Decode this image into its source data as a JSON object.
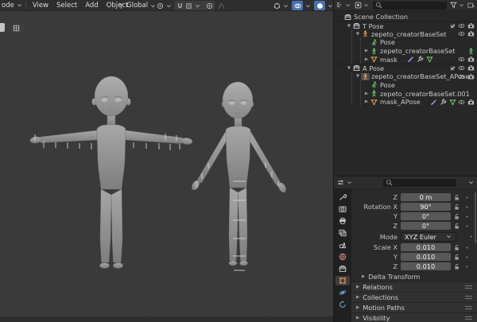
{
  "colors": {
    "accent": "#4772b4",
    "object_orange": "#ee9e55",
    "data_green": "#6ecf6e",
    "brush_purple": "#9b8ce8",
    "world_red": "#cf8080",
    "physics_blue": "#6f9fd8",
    "viewport_bg": "#3a3a3b"
  },
  "menubar": {
    "mode_label": "ode",
    "menus": [
      "View",
      "Select",
      "Add",
      "Object"
    ],
    "orientation_label": "Global"
  },
  "outliner": {
    "search_placeholder": "",
    "rows": [
      {
        "label": "Scene Collection",
        "level": 0,
        "icon": "collection",
        "icolor": "#cfcfcf",
        "right": []
      },
      {
        "label": "T Pose",
        "level": 1,
        "disc": "open",
        "icon": "collection",
        "icolor": "#cfcfcf",
        "right": [
          "check",
          "eye",
          "camera"
        ],
        "sep": true
      },
      {
        "label": "zepeto_creatorBaseSet",
        "level": 2,
        "disc": "open",
        "icon": "armature",
        "icolor": "#ee9e55",
        "right": [
          "eye",
          "camera"
        ]
      },
      {
        "label": "Pose",
        "level": 3,
        "icon": "pose",
        "icolor": "#6ecf6e",
        "right": []
      },
      {
        "label": "zepeto_creatorBaseSet",
        "level": 3,
        "disc": "closed",
        "icon": "armature",
        "icolor": "#6ecf6e",
        "right": [
          "badge-armature"
        ]
      },
      {
        "label": "mask",
        "level": 3,
        "disc": "closed",
        "icon": "mesh",
        "icolor": "#ee9e55",
        "badges": [
          "brush",
          "modifier",
          "mesh-green"
        ],
        "right": [
          "eye",
          "camera"
        ]
      },
      {
        "label": "A Pose",
        "level": 1,
        "disc": "open",
        "icon": "collection",
        "icolor": "#cfcfcf",
        "right": [
          "check",
          "eye",
          "camera"
        ],
        "sep": true
      },
      {
        "label": "zepeto_creatorBaseSet_APose",
        "level": 2,
        "disc": "open",
        "icon": "armature",
        "icolor": "#ee9e55",
        "iconbg": true,
        "right": [
          "eye",
          "camera"
        ]
      },
      {
        "label": "Pose",
        "level": 3,
        "icon": "pose",
        "icolor": "#6ecf6e",
        "right": []
      },
      {
        "label": "zepeto_creatorBaseSet.001",
        "level": 3,
        "disc": "closed",
        "icon": "armature",
        "icolor": "#6ecf6e",
        "right": []
      },
      {
        "label": "mask_APose",
        "level": 3,
        "disc": "closed",
        "icon": "mesh",
        "icolor": "#ee9e55",
        "badges": [
          "brush",
          "modifier",
          "mesh-green"
        ],
        "right": [
          "eye",
          "camera"
        ]
      }
    ]
  },
  "properties": {
    "search_placeholder": "",
    "tabs": [
      {
        "name": "tool",
        "color": "#c8c8c8"
      },
      {
        "name": "render",
        "color": "#c8c8c8"
      },
      {
        "name": "output",
        "color": "#c8c8c8"
      },
      {
        "name": "view-layer",
        "color": "#c8c8c8"
      },
      {
        "name": "scene",
        "color": "#c8c8c8"
      },
      {
        "name": "world",
        "color": "#cf8080"
      },
      {
        "name": "collection",
        "color": "#c8c8c8"
      },
      {
        "name": "object",
        "color": "#ee9e55",
        "active": true
      },
      {
        "name": "physics",
        "color": "#6f9fd8"
      },
      {
        "name": "constraints",
        "color": "#6f9fd8"
      }
    ],
    "fields": [
      {
        "label": "Z",
        "value": "0 m",
        "lock": true
      },
      {
        "label": "Rotation X",
        "value": "90°",
        "lock": true
      },
      {
        "label": "Y",
        "value": "0°",
        "lock": true
      },
      {
        "label": "Z",
        "value": "0°",
        "lock": true
      },
      {
        "label": "Mode",
        "value": "XYZ Euler",
        "type": "dropdown"
      },
      {
        "label": "Scale X",
        "value": "0.010",
        "lock": true
      },
      {
        "label": "Y",
        "value": "0.010",
        "lock": true
      },
      {
        "label": "Z",
        "value": "0.010",
        "lock": true
      }
    ],
    "subpanel_label": "Delta Transform",
    "panels": [
      "Relations",
      "Collections",
      "Motion Paths",
      "Visibility"
    ]
  }
}
